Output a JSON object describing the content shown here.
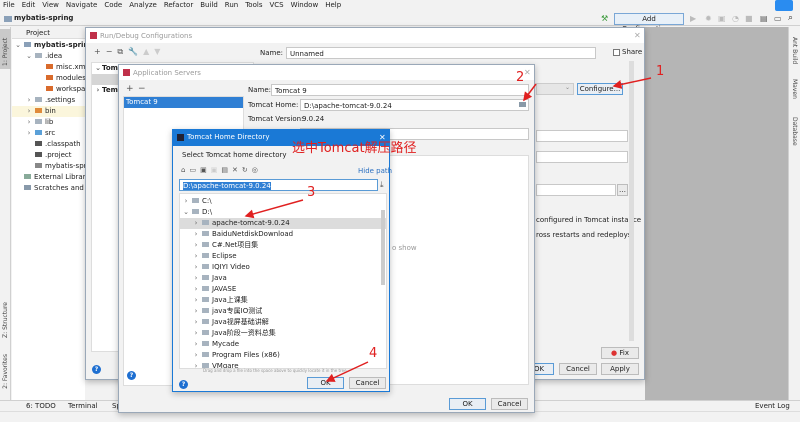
{
  "menu": [
    "File",
    "Edit",
    "View",
    "Navigate",
    "Code",
    "Analyze",
    "Refactor",
    "Build",
    "Run",
    "Tools",
    "VCS",
    "Window",
    "Help"
  ],
  "navbar": {
    "project_name": "mybatis-spring",
    "add_config_label": "Add Configuration..."
  },
  "left_strip": {
    "project": "1: Project",
    "structure": "Z: Structure",
    "favorites": "2: Favorites"
  },
  "right_strip": {
    "ant": "Ant Build",
    "maven": "Maven",
    "database": "Database"
  },
  "project_panel": {
    "header": "Project",
    "items": [
      {
        "label": "mybatis-spring",
        "depth": 0,
        "expanded": true,
        "icon": "module-folder"
      },
      {
        "label": ".idea",
        "depth": 1,
        "expanded": true,
        "icon": "folder"
      },
      {
        "label": "misc.xml",
        "depth": 2,
        "icon": "xml-file"
      },
      {
        "label": "modules.xml",
        "depth": 2,
        "icon": "xml-file"
      },
      {
        "label": "workspace.xml",
        "depth": 2,
        "icon": "xml-file"
      },
      {
        "label": ".settings",
        "depth": 1,
        "expanded": false,
        "icon": "folder"
      },
      {
        "label": "bin",
        "depth": 1,
        "expanded": false,
        "icon": "excluded-folder"
      },
      {
        "label": "lib",
        "depth": 1,
        "expanded": false,
        "icon": "folder"
      },
      {
        "label": "src",
        "depth": 1,
        "expanded": false,
        "icon": "source-folder"
      },
      {
        "label": ".classpath",
        "depth": 1,
        "icon": "file"
      },
      {
        "label": ".project",
        "depth": 1,
        "icon": "file"
      },
      {
        "label": "mybatis-spring.iml",
        "depth": 1,
        "icon": "iml-file"
      },
      {
        "label": "External Libraries",
        "depth": 0,
        "icon": "libraries"
      },
      {
        "label": "Scratches and Consoles",
        "depth": 0,
        "icon": "scratches"
      }
    ]
  },
  "run_debug": {
    "title": "Run/Debug Configurations",
    "name_label": "Name:",
    "name_value": "Unnamed",
    "share_label": "Share",
    "tree": [
      {
        "label": "Tomcat Server"
      },
      {
        "label": "Templates"
      }
    ],
    "configure_label": "Configure...",
    "text1": "configured in Tomcat instance",
    "text2": "ross restarts and redeploys",
    "fix_label": "Fix",
    "ok_label": "OK",
    "cancel_label": "Cancel",
    "apply_label": "Apply"
  },
  "app_servers": {
    "title": "Application Servers",
    "servers": [
      "Tomcat 9"
    ],
    "name_label": "Name:",
    "name_value": "Tomcat 9",
    "home_label": "Tomcat Home:",
    "home_value": "D:\\apache-tomcat-9.0.24",
    "version_label": "Tomcat Version:",
    "version_value": "9.0.24",
    "base_value": "24",
    "partial_text": "o show",
    "ok_label": "OK",
    "cancel_label": "Cancel"
  },
  "home_dir": {
    "title": "Tomcat Home Directory",
    "subtitle": "Select Tomcat home directory",
    "hide_path": "Hide path",
    "path_value": "D:\\apache-tomcat-9.0.24",
    "roots": [
      {
        "label": "C:\\",
        "expanded": false
      },
      {
        "label": "D:\\",
        "expanded": true
      }
    ],
    "folders": [
      "apache-tomcat-9.0.24",
      "BaiduNetdiskDownload",
      "C#.Net项目集",
      "Eclipse",
      "IQIYI Video",
      "Java",
      "JAVASE",
      "Java上课集",
      "java专属IO测试",
      "Java视屏基础讲解",
      "Java阶段一资料总集",
      "Mycade",
      "Program Files (x86)",
      "VMgare"
    ],
    "selected": "apache-tomcat-9.0.24",
    "hint": "Drag and drop a file into the space above to quickly locate it in the tree",
    "ok_label": "OK",
    "cancel_label": "Cancel"
  },
  "annotations": {
    "step1": "1",
    "step2": "2",
    "step3": "3",
    "step4": "4",
    "note": "选中Tomcat解压路径",
    "color": "#e02020"
  },
  "bottom_bar": {
    "todo": "6: TODO",
    "terminal": "Terminal",
    "spring": "Sp",
    "event_log": "Event Log"
  },
  "colors": {
    "accent": "#1e6fd1",
    "selection": "#2f7fd4",
    "title_blue": "#1a79d6"
  }
}
